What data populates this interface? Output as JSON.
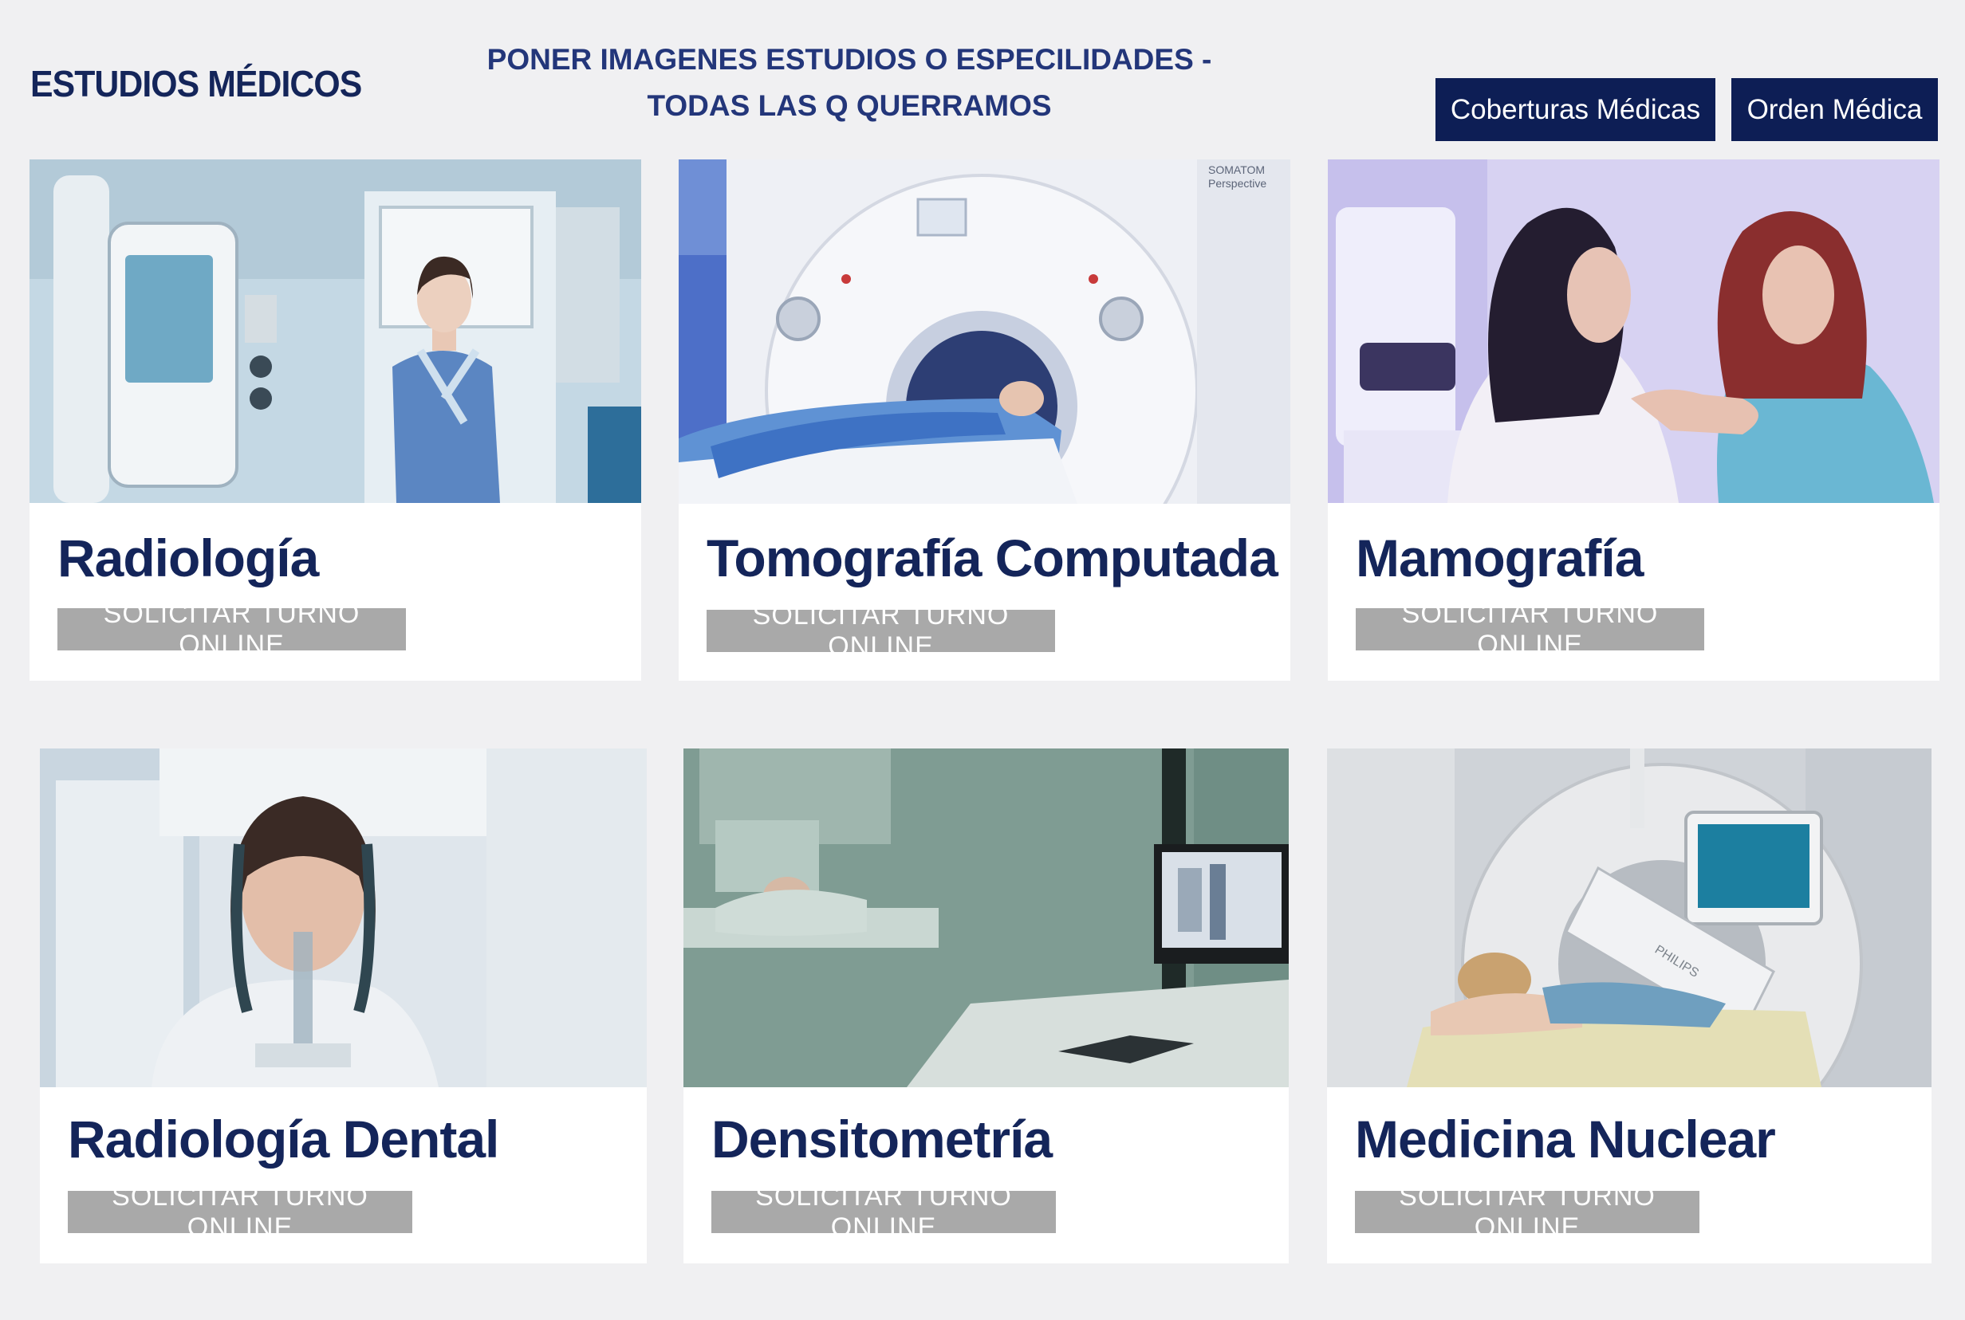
{
  "header": {
    "title": "ESTUDIOS MÉDICOS",
    "note_line1": "PONER IMAGENES ESTUDIOS O ESPECILIDADES -",
    "note_line2": "TODAS LAS Q QUERRAMOS",
    "buttons": [
      "Coberturas Médicas",
      "Orden Médica"
    ]
  },
  "cta_label": "SOLICITAR TURNO ONLINE",
  "cards": [
    {
      "title": "Radiología",
      "image": "x-ray-patient-photo"
    },
    {
      "title": "Tomografía Computada",
      "image": "ct-scanner-photo",
      "machine_text": [
        "SOMATOM",
        "Perspective"
      ]
    },
    {
      "title": "Mamografía",
      "image": "mammography-photo"
    },
    {
      "title": "Radiología Dental",
      "image": "dental-xray-photo"
    },
    {
      "title": "Densitometría",
      "image": "densitometry-photo"
    },
    {
      "title": "Medicina Nuclear",
      "image": "gamma-camera-photo",
      "machine_text": [
        "PHILIPS"
      ]
    }
  ],
  "colors": {
    "navy": "#0d1e55",
    "title": "#14255a",
    "cta": "#a9a9a9",
    "bg": "#f0f0f2"
  }
}
